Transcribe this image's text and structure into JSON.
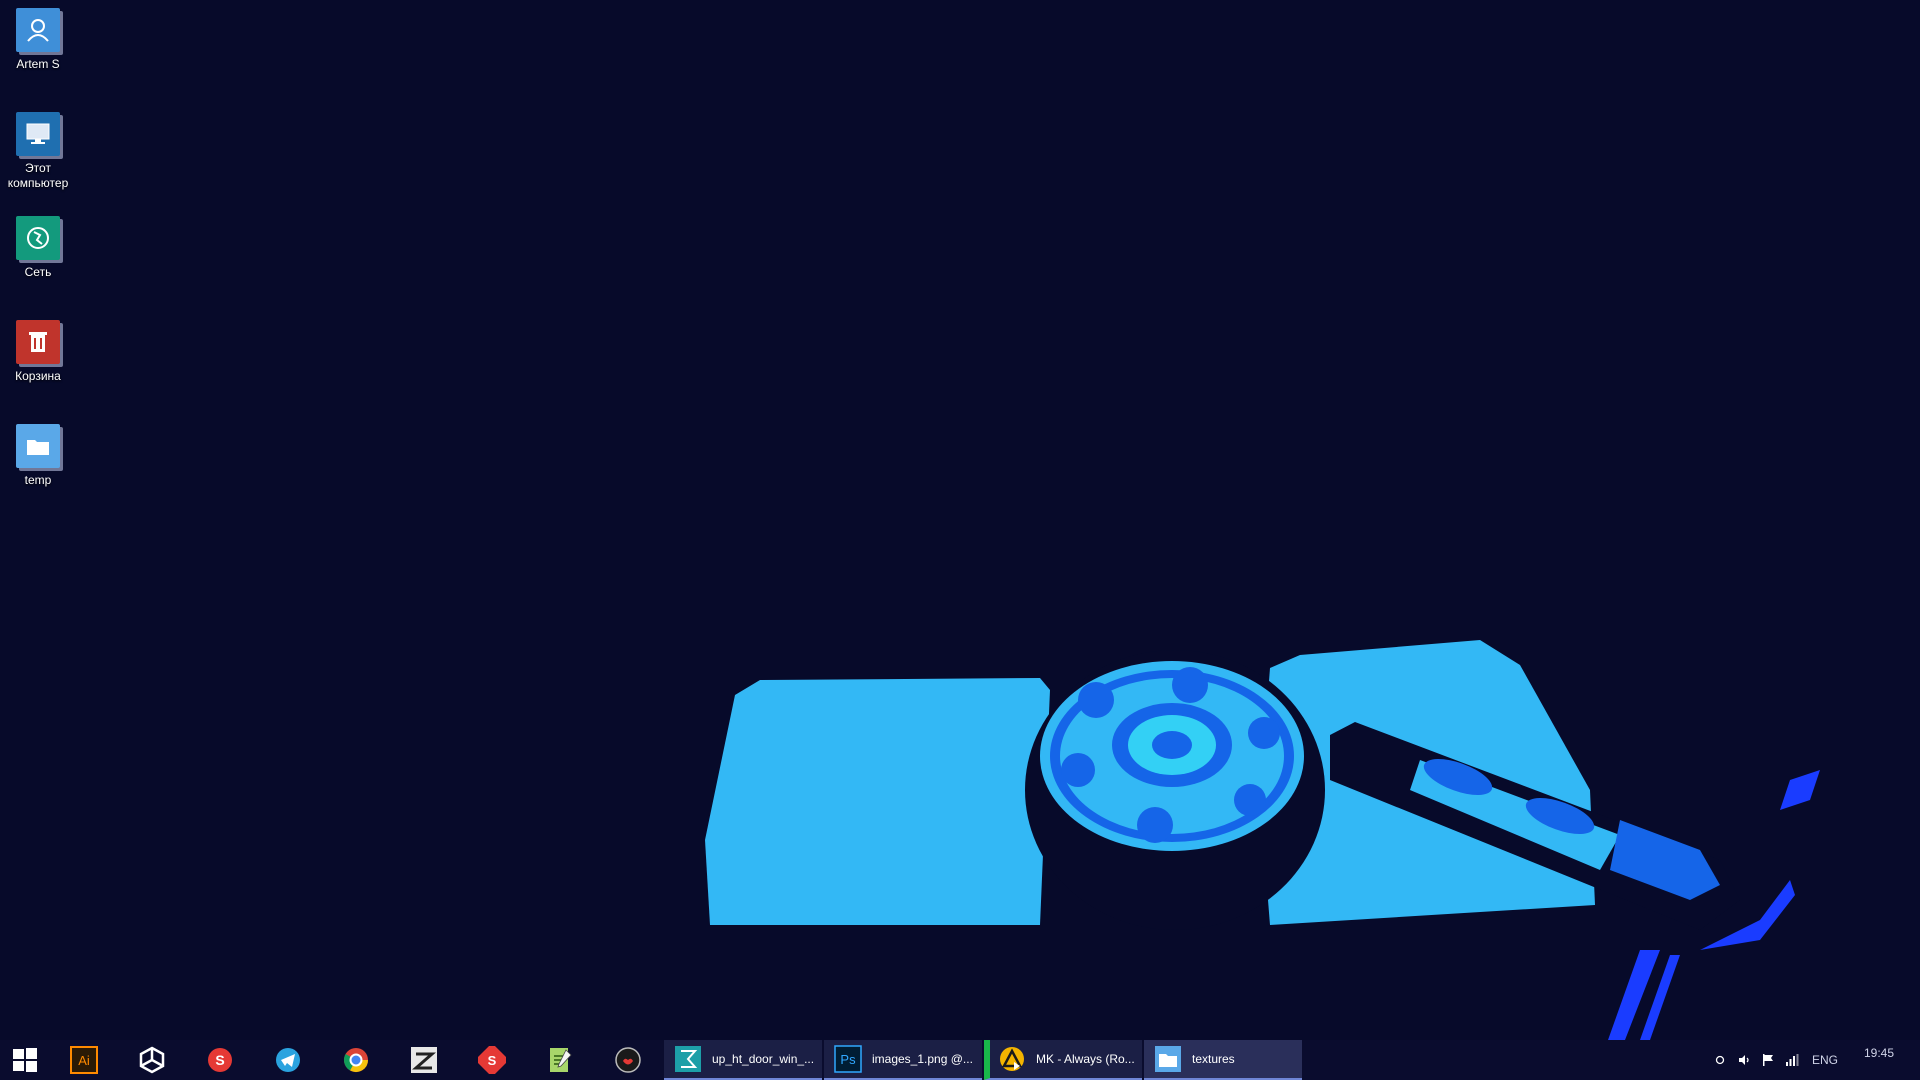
{
  "desktop": {
    "icons": [
      {
        "label": "Artem S",
        "icon": "user-folder-icon",
        "color": "#3f8fd8"
      },
      {
        "label": "Этот компьютер",
        "icon": "computer-icon",
        "color": "#1f6fb0"
      },
      {
        "label": "Сеть",
        "icon": "network-icon",
        "color": "#139a7d"
      },
      {
        "label": "Корзина",
        "icon": "recycle-bin-icon",
        "color": "#c0342c"
      },
      {
        "label": "temp",
        "icon": "folder-icon",
        "color": "#5aa8e8"
      }
    ],
    "wallpaper": "hard-drive-posterized",
    "background_color": "#070a2a"
  },
  "taskbar": {
    "pinned": [
      {
        "name": "start-button",
        "icon": "windows-logo-icon"
      },
      {
        "name": "illustrator",
        "icon": "illustrator-icon",
        "text": "Ai"
      },
      {
        "name": "unity",
        "icon": "unity-icon"
      },
      {
        "name": "substance-painter",
        "icon": "substance-icon"
      },
      {
        "name": "telegram",
        "icon": "telegram-icon"
      },
      {
        "name": "chrome",
        "icon": "chrome-icon"
      },
      {
        "name": "zbrush",
        "icon": "zbrush-icon"
      },
      {
        "name": "substance-designer",
        "icon": "substance-designer-icon"
      },
      {
        "name": "notepad-plus",
        "icon": "notepad-icon"
      },
      {
        "name": "marmoset",
        "icon": "marmoset-icon"
      }
    ],
    "tasks": [
      {
        "label": "up_ht_door_win_...",
        "icon": "3ds-max-icon",
        "color": "#1d9fa8"
      },
      {
        "label": "images_1.png @...",
        "icon": "photoshop-icon",
        "color": "#31a8ff"
      },
      {
        "label": "MK - Always (Ro...",
        "icon": "aimp-icon",
        "color": "#f4b400"
      },
      {
        "label": "textures",
        "icon": "file-explorer-icon",
        "color": "#5aa8e8"
      }
    ]
  },
  "tray": {
    "language": "ENG",
    "time": "19:45"
  }
}
